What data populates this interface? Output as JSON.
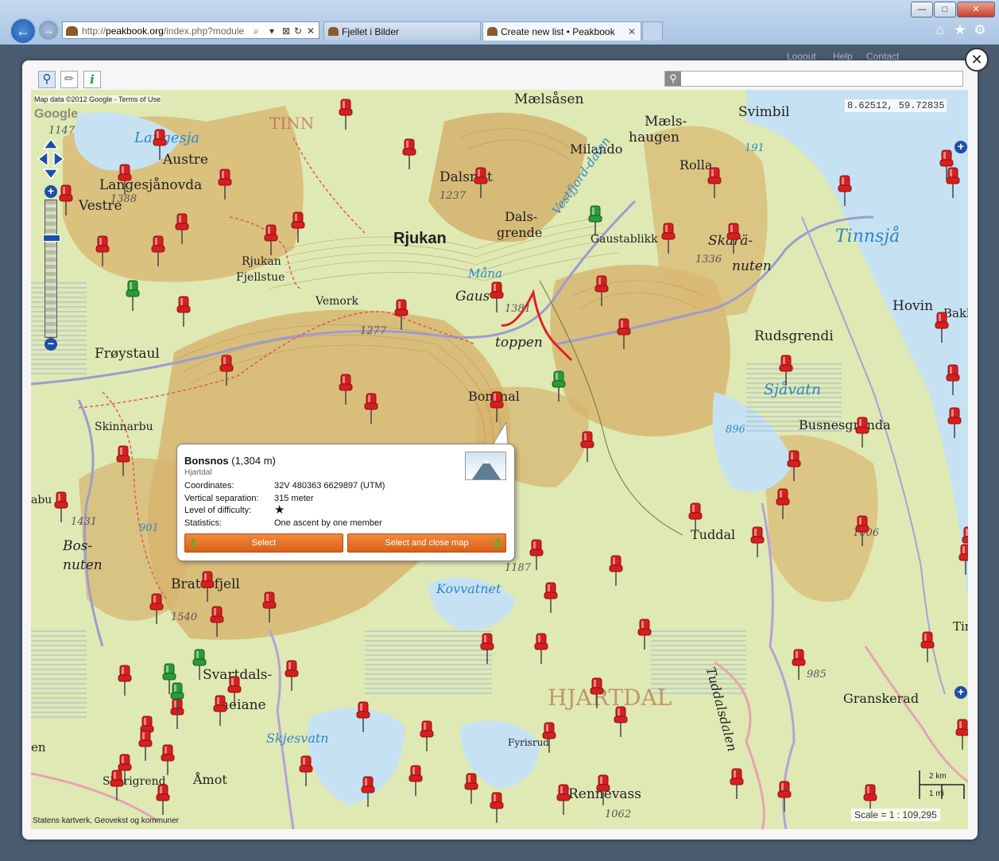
{
  "browser": {
    "window_buttons": [
      "—",
      "□",
      "✕"
    ],
    "address_prefix": "http://",
    "address_domain": "peakbook.org",
    "address_rest": "/index.php?module",
    "address_icons": [
      "⌕",
      "▾",
      "⊠",
      "↻",
      "✕"
    ],
    "tabs": [
      {
        "label": "Fjellet i Bilder",
        "active": false
      },
      {
        "label": "Create new list • Peakbook",
        "active": true
      }
    ],
    "right_icons": [
      "⌂",
      "★",
      "⚙"
    ]
  },
  "page_links": [
    "Logout",
    "Help",
    "Contact"
  ],
  "modal": {
    "close_label": "✕",
    "tools": [
      "zoom-icon",
      "ruler-icon",
      "info-icon"
    ],
    "search_placeholder": ""
  },
  "map": {
    "attribution": "Map data ©2012 Google - Terms of Use",
    "google_logo": "Google",
    "coordinates": "8.62512, 59.72835",
    "scale": "Scale = 1 : 109,295",
    "scale_km": "2 km",
    "scale_mi": "1 mi",
    "footer": "Statens kartverk, Geovekst og kommuner",
    "zoom_plus": "+",
    "zoom_minus": "−",
    "labels": {
      "rjukan": "Rjukan",
      "maelsasen": "Mælsåsen",
      "maelshaugen_1": "Mæls-",
      "maelshaugen_2": "haugen",
      "milando": "Milando",
      "svimbil": "Svimbil",
      "lauvnesa": "Laugesja",
      "austre": "Austre",
      "langesjanovda": "Langesjånovda",
      "vestre": "Vestre",
      "tinn": "TINN",
      "dalsnut": "Dalsnut",
      "dals": "Dals-",
      "grende": "grende",
      "gaustablikk": "Gaustablikk",
      "skara": "Skarä-",
      "nuten": "nuten",
      "rolla": "Rolla",
      "rjukan_fjellstue_1": "Rjukan",
      "rjukan_fjellstue_2": "Fjellstue",
      "vemork": "Vemork",
      "gaus": "Gaus",
      "toppen": "toppen",
      "froystaul": "Frøystaul",
      "rudsgrendi": "Rudsgrendi",
      "hovin": "Hovin",
      "bakke": "Bakk",
      "bonsnos_lbl": "Bonsnal",
      "skinnarbu": "Skinnarbu",
      "busnesgrenda": "Busnesgrenda",
      "abu": "abu",
      "bos": "Bos-",
      "bosnuten": "nuten",
      "tuddal": "Tuddal",
      "brattefjell": "Brattefjell",
      "svartdals": "Svartdals-",
      "heiane": "heiane",
      "hjartdal": "HJARTDAL",
      "granskerad": "Granskerad",
      "tuddalsdalen": "Tuddalsdalen",
      "fyrisrud": "Fyrisrud",
      "rennevass": "Rennevass",
      "amot": "Åmot",
      "skorigrend": "Skorigrend",
      "en": "en",
      "tinn2": "Tinn"
    },
    "water_labels": {
      "tinnsja": "Tinnsjå",
      "sjavatn": "Sjåvatn",
      "kovvatnet": "Kovvatnet",
      "skjesvatn": "Skjesvatn",
      "mane": "Måna",
      "dalen": "Vestfjord-dalen"
    },
    "elevations": [
      "1388",
      "1237",
      "1336",
      "1381",
      "1277",
      "191",
      "896",
      "1431",
      "901",
      "1540",
      "1187",
      "985",
      "1062",
      "1006",
      "1147"
    ]
  },
  "popup": {
    "name": "Bonsnos",
    "height": "(1,304 m)",
    "region": "Hjartdal",
    "rows": [
      {
        "label": "Coordinates:",
        "value": "32V 480363 6629897 (UTM)"
      },
      {
        "label": "Vertical separation:",
        "value": "315 meter"
      },
      {
        "label": "Level of difficulty:",
        "value": "★"
      },
      {
        "label": "Statistics:",
        "value": "One ascent by one member"
      }
    ],
    "select_label": "Select",
    "select_num": "1",
    "select_close_label": "Select and close map",
    "select_close_num": "2"
  }
}
